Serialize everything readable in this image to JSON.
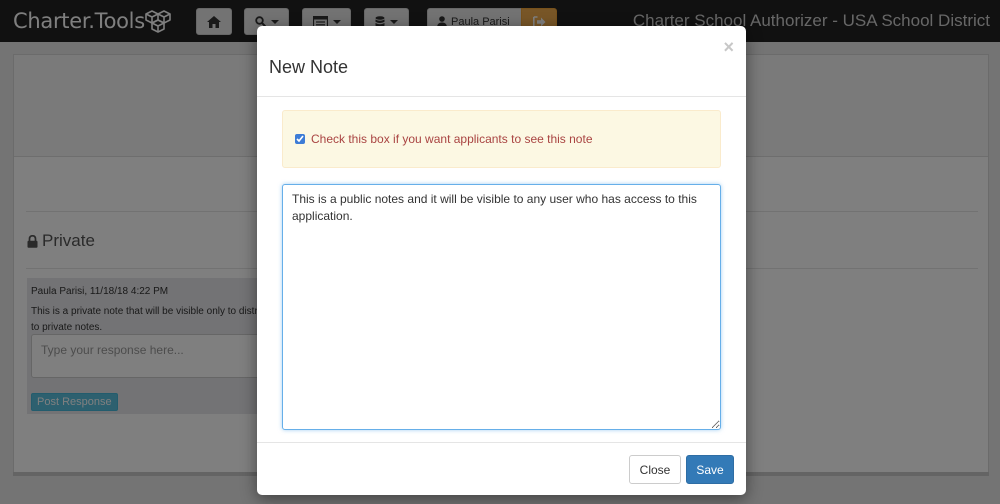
{
  "navbar": {
    "brand": "Charter.Tools",
    "brand_icon": "cubes-icon",
    "home_icon": "home-icon",
    "search_icon": "search-icon",
    "list_icon": "list-icon",
    "database_icon": "database-icon",
    "user_name": "Paula Parisi",
    "logout_icon": "sign-out-icon",
    "org_title": "Charter School Authorizer - USA School District"
  },
  "page": {
    "private_heading": "Private",
    "note_meta": "Paula Parisi, 11/18/18 4:22 PM",
    "note_text_line1": "This is a private note that will be visible only to distri",
    "note_text_line2": "to private notes.",
    "response_placeholder": "Type your response here...",
    "post_response_label": "Post Response"
  },
  "modal": {
    "title": "New Note",
    "close_symbol": "×",
    "public_checkbox_label": "Check this box if you want applicants to see this note",
    "public_checked": true,
    "note_value": "This is a public notes and it will be visible to any user who has access to this application.",
    "close_label": "Close",
    "save_label": "Save"
  },
  "colors": {
    "navbar_bg": "#222222",
    "logout_bg": "#f0ad4e",
    "alert_bg": "#fcf8e3",
    "alert_text": "#a94442",
    "save_btn": "#337ab7",
    "post_btn": "#5bc0de"
  }
}
